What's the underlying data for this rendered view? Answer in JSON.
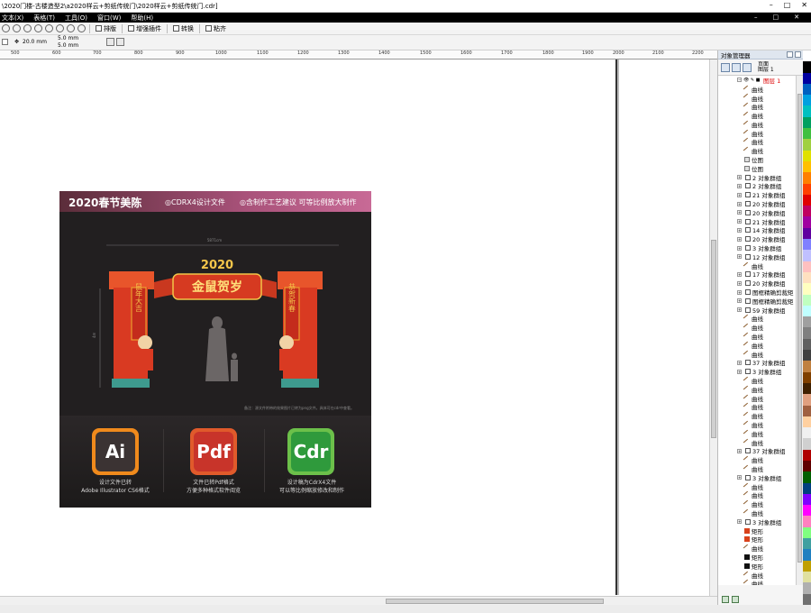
{
  "window": {
    "title": "\\2020门楼-古楼造型2\\a2020样云+剪纸传统门\\2020样云+剪纸传统门.cdr]",
    "min": "–",
    "max": "□",
    "close": "✕"
  },
  "menu": {
    "items": [
      "文本(X)",
      "表格(T)",
      "工具(O)",
      "窗口(W)",
      "帮助(H)"
    ],
    "mdi_min": "–",
    "mdi_max": "□",
    "mdi_close": "✕"
  },
  "toolbar": {
    "arrange": "排版",
    "enhance": "增强插件",
    "convert": "转换",
    "paste": "粘齐"
  },
  "propbar": {
    "nudge": "20.0 mm",
    "dup_x": "5.0 mm",
    "dup_y": "5.0 mm"
  },
  "ruler": {
    "ticks": [
      "500",
      "600",
      "700",
      "800",
      "900",
      "1000",
      "1100",
      "1200",
      "1300",
      "1400",
      "1500",
      "1600",
      "1700",
      "1800",
      "1900",
      "2000",
      "2100",
      "2200"
    ]
  },
  "artwork": {
    "headline": "2020春节美陈",
    "badge1": "◎CDRX4设计文件",
    "badge2": "◎含制作工艺建议 可等比例放大制作",
    "dimension": "5871cm",
    "height_dim": "4m",
    "gate_year": "2020",
    "gate_title": "金鼠贺岁",
    "couplet_left": "鼠年大吉",
    "couplet_right": "恭贺新春",
    "note": "备注：源文件附带的效果图片已转为png文件。具体可在cdr中查看。",
    "formats": [
      {
        "label": "Ai",
        "caption1": "设计文件已转",
        "caption2": "Adobe Illustrator CS6格式",
        "color": "#f08a1c",
        "inner": "#3b3333"
      },
      {
        "label": "Pdf",
        "caption1": "文件已转Pdf格式",
        "caption2": "方便多种格式软件阅览",
        "color": "#e05a2b",
        "inner": "#c8342a"
      },
      {
        "label": "Cdr",
        "caption1": "设计稿为CdrX4文件",
        "caption2": "可以等比例缩放修改和制作",
        "color": "#6cc04a",
        "inner": "#2f9a3c"
      }
    ]
  },
  "object_manager": {
    "title": "对象管理器",
    "page_label": "页面",
    "layer_label": "图层 1",
    "layer_row": "图层 1",
    "rows": [
      {
        "type": "curve",
        "text": "曲线"
      },
      {
        "type": "curve",
        "text": "曲线"
      },
      {
        "type": "curve",
        "text": "曲线"
      },
      {
        "type": "curve",
        "text": "曲线"
      },
      {
        "type": "curve",
        "text": "曲线"
      },
      {
        "type": "curve",
        "text": "曲线"
      },
      {
        "type": "curve",
        "text": "曲线"
      },
      {
        "type": "curve",
        "text": "曲线"
      },
      {
        "type": "bitmap",
        "text": "位图"
      },
      {
        "type": "bitmap",
        "text": "位图"
      },
      {
        "type": "group",
        "text": "2 对象群组"
      },
      {
        "type": "group",
        "text": "2 对象群组"
      },
      {
        "type": "group",
        "text": "21 对象群组"
      },
      {
        "type": "group",
        "text": "20 对象群组"
      },
      {
        "type": "group",
        "text": "20 对象群组"
      },
      {
        "type": "group",
        "text": "21 对象群组"
      },
      {
        "type": "group",
        "text": "14 对象群组"
      },
      {
        "type": "group",
        "text": "20 对象群组"
      },
      {
        "type": "group",
        "text": "3 对象群组"
      },
      {
        "type": "group",
        "text": "12 对象群组"
      },
      {
        "type": "curve",
        "text": "曲线"
      },
      {
        "type": "group",
        "text": "17 对象群组"
      },
      {
        "type": "group",
        "text": "20 对象群组"
      },
      {
        "type": "group",
        "text": "图框精确剪裁矩"
      },
      {
        "type": "group",
        "text": "图框精确剪裁矩"
      },
      {
        "type": "group",
        "text": "59 对象群组"
      },
      {
        "type": "curve",
        "text": "曲线"
      },
      {
        "type": "curve",
        "text": "曲线"
      },
      {
        "type": "curve",
        "text": "曲线"
      },
      {
        "type": "curve",
        "text": "曲线"
      },
      {
        "type": "curve",
        "text": "曲线"
      },
      {
        "type": "group",
        "text": "37 对象群组"
      },
      {
        "type": "group",
        "text": "3 对象群组"
      },
      {
        "type": "curve",
        "text": "曲线"
      },
      {
        "type": "curve",
        "text": "曲线"
      },
      {
        "type": "curve",
        "text": "曲线"
      },
      {
        "type": "curve",
        "text": "曲线"
      },
      {
        "type": "curve",
        "text": "曲线"
      },
      {
        "type": "curve",
        "text": "曲线"
      },
      {
        "type": "curve",
        "text": "曲线"
      },
      {
        "type": "curve",
        "text": "曲线"
      },
      {
        "type": "group",
        "text": "37 对象群组"
      },
      {
        "type": "curve",
        "text": "曲线"
      },
      {
        "type": "curve",
        "text": "曲线"
      },
      {
        "type": "group",
        "text": "3 对象群组"
      },
      {
        "type": "curve",
        "text": "曲线"
      },
      {
        "type": "curve",
        "text": "曲线"
      },
      {
        "type": "curve",
        "text": "曲线"
      },
      {
        "type": "curve",
        "text": "曲线"
      },
      {
        "type": "group",
        "text": "3 对象群组"
      },
      {
        "type": "rect-red",
        "text": "矩形"
      },
      {
        "type": "rect-red",
        "text": "矩形"
      },
      {
        "type": "curve",
        "text": "曲线"
      },
      {
        "type": "rect-black",
        "text": "矩形"
      },
      {
        "type": "rect-black",
        "text": "矩形"
      },
      {
        "type": "curve",
        "text": "曲线"
      },
      {
        "type": "curve",
        "text": "曲线"
      },
      {
        "type": "rect-black",
        "text": "矩形"
      }
    ]
  },
  "palette": [
    "#ffffff",
    "#000000",
    "#0000a0",
    "#0060c0",
    "#00a0e0",
    "#00c0c0",
    "#00a060",
    "#40c040",
    "#a0d040",
    "#e0e000",
    "#ffc000",
    "#ff8000",
    "#ff4000",
    "#e00000",
    "#c00060",
    "#a000a0",
    "#6000a0",
    "#8080ff",
    "#c0c0ff",
    "#ffc0c0",
    "#ffe0c0",
    "#ffffc0",
    "#c0ffc0",
    "#c0ffff",
    "#a0a0a0",
    "#808080",
    "#606060",
    "#404040",
    "#c08040",
    "#804000",
    "#402000",
    "#e0a080",
    "#a06040",
    "#ffd0a0",
    "#f0f0f0",
    "#d0d0d0",
    "#b00000",
    "#600000",
    "#006000",
    "#004080",
    "#8000ff",
    "#ff00ff",
    "#ff80c0",
    "#80ff80",
    "#40a0a0",
    "#2080c0",
    "#c0a000",
    "#e0e0a0",
    "#b0b0b0",
    "#707070"
  ]
}
